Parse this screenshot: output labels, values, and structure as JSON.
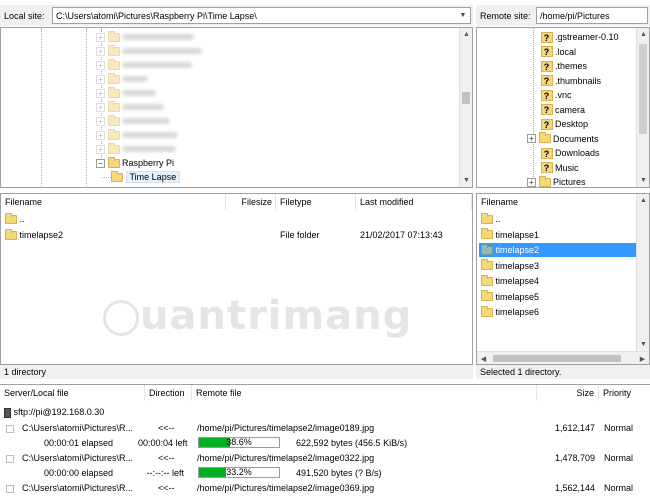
{
  "local_site": {
    "label": "Local site:",
    "path": "C:\\Users\\atomi\\Pictures\\Raspberry Pi\\Time Lapse\\",
    "tree": {
      "parent": "Raspberry Pi",
      "selected": "Time Lapse"
    },
    "columns": [
      "Filename",
      "Filesize",
      "Filetype",
      "Last modified"
    ],
    "files": [
      {
        "name": "..",
        "size": "",
        "type": "",
        "modified": ""
      },
      {
        "name": "timelapse2",
        "size": "",
        "type": "File folder",
        "modified": "21/02/2017 07:13:43"
      }
    ],
    "status": "1 directory"
  },
  "remote_site": {
    "label": "Remote site:",
    "path": "/home/pi/Pictures",
    "tree": [
      {
        "name": ".gstreamer-0.10",
        "icon": "unknown-folder-icon",
        "expander": false
      },
      {
        "name": ".local",
        "icon": "unknown-folder-icon",
        "expander": false
      },
      {
        "name": ".themes",
        "icon": "unknown-folder-icon",
        "expander": false
      },
      {
        "name": ".thumbnails",
        "icon": "unknown-folder-icon",
        "expander": false
      },
      {
        "name": ".vnc",
        "icon": "unknown-folder-icon",
        "expander": false
      },
      {
        "name": "camera",
        "icon": "unknown-folder-icon",
        "expander": false
      },
      {
        "name": "Desktop",
        "icon": "unknown-folder-icon",
        "expander": false
      },
      {
        "name": "Documents",
        "icon": "folder-icon",
        "expander": true
      },
      {
        "name": "Downloads",
        "icon": "unknown-folder-icon",
        "expander": false
      },
      {
        "name": "Music",
        "icon": "unknown-folder-icon",
        "expander": false
      },
      {
        "name": "Pictures",
        "icon": "folder-icon",
        "expander": true
      }
    ],
    "columns": [
      "Filename"
    ],
    "files": [
      {
        "name": "..",
        "selected": false
      },
      {
        "name": "timelapse1",
        "selected": false
      },
      {
        "name": "timelapse2",
        "selected": true
      },
      {
        "name": "timelapse3",
        "selected": false
      },
      {
        "name": "timelapse4",
        "selected": false
      },
      {
        "name": "timelapse5",
        "selected": false
      },
      {
        "name": "timelapse6",
        "selected": false
      }
    ],
    "status": "Selected 1 directory."
  },
  "queue": {
    "columns": [
      "Server/Local file",
      "Direction",
      "Remote file",
      "Size",
      "Priority"
    ],
    "server": "sftp://pi@192.168.0.30",
    "transfers": [
      {
        "local": "C:\\Users\\atomi\\Pictures\\R...",
        "direction": "<<--",
        "remote": "/home/pi/Pictures/timelapse2/image0189.jpg",
        "size": "1,612,147",
        "priority": "Normal",
        "elapsed": "00:00:01 elapsed",
        "left": "00:00:04 left",
        "progress": 0.386,
        "progress_label": "38.6%",
        "bytes": "622,592 bytes (456.5 KiB/s)"
      },
      {
        "local": "C:\\Users\\atomi\\Pictures\\R...",
        "direction": "<<--",
        "remote": "/home/pi/Pictures/timelapse2/image0322.jpg",
        "size": "1,478,709",
        "priority": "Normal",
        "elapsed": "00:00:00 elapsed",
        "left": "--:--:-- left",
        "progress": 0.332,
        "progress_label": "33.2%",
        "bytes": "491,520 bytes (? B/s)"
      },
      {
        "local": "C:\\Users\\atomi\\Pictures\\R...",
        "direction": "<<--",
        "remote": "/home/pi/Pictures/timelapse2/image0369.jpg",
        "size": "1,562,144",
        "priority": "Normal"
      }
    ]
  },
  "watermark": "uantrimang",
  "colors": {
    "selection": "#3399ff",
    "progress": "#06b025",
    "folder": "#f6d77a"
  }
}
